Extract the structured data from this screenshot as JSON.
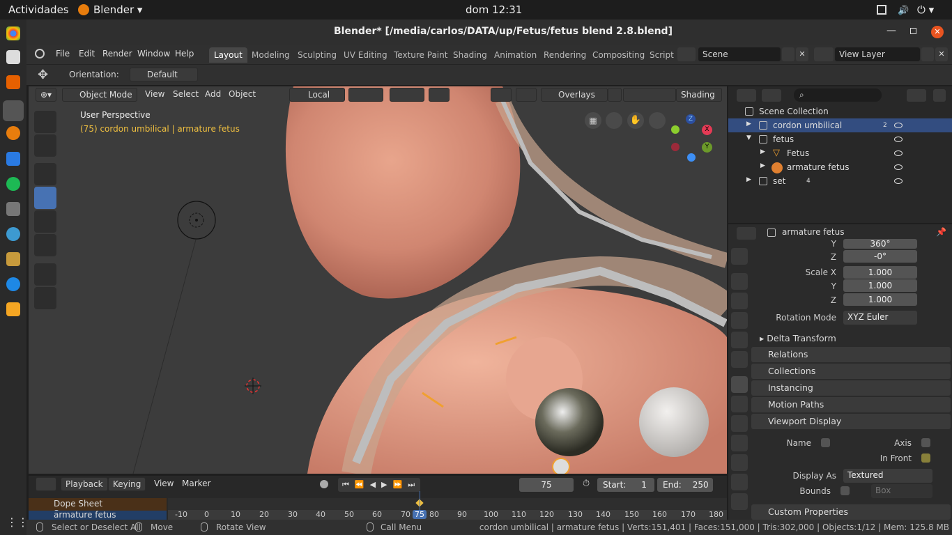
{
  "os_bar": {
    "activities": "Actividades",
    "app": "Blender ▾",
    "clock": "dom 12:31"
  },
  "window": {
    "title": "Blender* [/media/carlos/DATA/up/Fetus/fetus blend 2.8.blend]"
  },
  "menu": [
    "File",
    "Edit",
    "Render",
    "Window",
    "Help"
  ],
  "workspaces": [
    "Layout",
    "Modeling",
    "Sculpting",
    "UV Editing",
    "Texture Paint",
    "Shading",
    "Animation",
    "Rendering",
    "Compositing",
    "Script"
  ],
  "scene": "Scene",
  "view_layer": "View Layer",
  "tool_header": {
    "orientation_label": "Orientation:",
    "orientation_value": "Default"
  },
  "viewport": {
    "mode": "Object Mode",
    "menus": [
      "View",
      "Select",
      "Add",
      "Object"
    ],
    "transform": "Local",
    "overlays": "Overlays",
    "shading": "Shading",
    "perspective": "User Perspective",
    "info": "(75) cordon umbilical | armature fetus",
    "axes": {
      "x": "X",
      "y": "Y",
      "z": "Z"
    }
  },
  "outliner": {
    "root": "Scene Collection",
    "rows": [
      {
        "name": "cordon umbilical",
        "badge": "2"
      },
      {
        "name": "fetus"
      },
      {
        "name": "Fetus"
      },
      {
        "name": "armature fetus"
      },
      {
        "name": "set",
        "badge": "4"
      }
    ]
  },
  "properties": {
    "object_name": "armature fetus",
    "rot_y_label": "Y",
    "rot_y": "360°",
    "rot_z_label": "Z",
    "rot_z": "-0°",
    "scale_x_label": "Scale X",
    "scale_x": "1.000",
    "scale_y_label": "Y",
    "scale_y": "1.000",
    "scale_z_label": "Z",
    "scale_z": "1.000",
    "rotation_mode_label": "Rotation Mode",
    "rotation_mode": "XYZ Euler",
    "panels": [
      "Delta Transform",
      "Relations",
      "Collections",
      "Instancing",
      "Motion Paths",
      "Viewport Display"
    ],
    "vd": {
      "name": "Name",
      "axis": "Axis",
      "in_front": "In Front",
      "display_as_label": "Display As",
      "display_as": "Textured",
      "bounds": "Bounds",
      "bounds_type": "Box"
    },
    "custom": "Custom Properties"
  },
  "timeline": {
    "menus": [
      "Playback",
      "Keying",
      "View",
      "Marker"
    ],
    "frame": "75",
    "start_label": "Start:",
    "start": "1",
    "end_label": "End:",
    "end": "250",
    "rows": [
      "Dope Sheet Summary",
      "armature fetus"
    ],
    "ruler": [
      "-10",
      "0",
      "10",
      "20",
      "30",
      "40",
      "50",
      "60",
      "70",
      "75",
      "80",
      "90",
      "100",
      "110",
      "120",
      "130",
      "140",
      "150",
      "160",
      "170",
      "180"
    ]
  },
  "status": {
    "select": "Select or Deselect All",
    "move": "Move",
    "rotate": "Rotate View",
    "menu": "Call Menu",
    "info": "cordon umbilical | armature fetus | Verts:151,401 | Faces:151,000 | Tris:302,000 | Objects:1/12 | Mem: 125.8 MB"
  }
}
